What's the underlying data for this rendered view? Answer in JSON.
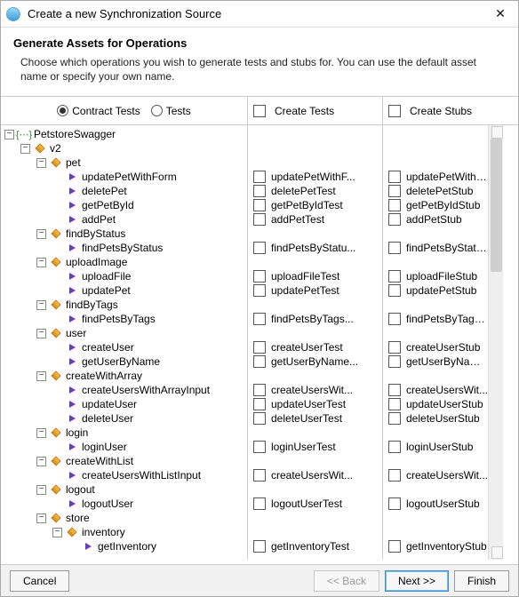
{
  "window": {
    "title": "Create a new Synchronization Source"
  },
  "header": {
    "title": "Generate Assets for Operations",
    "description": "Choose which operations you wish to generate tests and stubs for. You can use the default asset name or specify your own name."
  },
  "columns": {
    "radio_contract": "Contract Tests",
    "radio_tests": "Tests",
    "radio_selected": "contract",
    "create_tests": "Create Tests",
    "create_stubs": "Create Stubs"
  },
  "tree": [
    {
      "indent": 0,
      "exp": "-",
      "icon": "root",
      "label": "PetstoreSwagger",
      "test": "",
      "stub": ""
    },
    {
      "indent": 1,
      "exp": "-",
      "icon": "diamond",
      "label": "v2",
      "test": "",
      "stub": ""
    },
    {
      "indent": 2,
      "exp": "-",
      "icon": "diamond",
      "label": "pet",
      "test": "",
      "stub": ""
    },
    {
      "indent": 3,
      "exp": "",
      "icon": "arrow",
      "label": "updatePetWithForm",
      "test": "updatePetWithF...",
      "stub": "updatePetWithF..."
    },
    {
      "indent": 3,
      "exp": "",
      "icon": "arrow",
      "label": "deletePet",
      "test": "deletePetTest",
      "stub": "deletePetStub"
    },
    {
      "indent": 3,
      "exp": "",
      "icon": "arrow",
      "label": "getPetById",
      "test": "getPetByIdTest",
      "stub": "getPetByIdStub"
    },
    {
      "indent": 3,
      "exp": "",
      "icon": "arrow",
      "label": "addPet",
      "test": "addPetTest",
      "stub": "addPetStub"
    },
    {
      "indent": 2,
      "exp": "-",
      "icon": "diamond",
      "label": "findByStatus",
      "test": "",
      "stub": ""
    },
    {
      "indent": 3,
      "exp": "",
      "icon": "arrow",
      "label": "findPetsByStatus",
      "test": "findPetsByStatu...",
      "stub": "findPetsByStatu..."
    },
    {
      "indent": 2,
      "exp": "-",
      "icon": "diamond",
      "label": "uploadImage",
      "test": "",
      "stub": ""
    },
    {
      "indent": 3,
      "exp": "",
      "icon": "arrow",
      "label": "uploadFile",
      "test": "uploadFileTest",
      "stub": "uploadFileStub"
    },
    {
      "indent": 3,
      "exp": "",
      "icon": "arrow",
      "label": "updatePet",
      "test": "updatePetTest",
      "stub": "updatePetStub"
    },
    {
      "indent": 2,
      "exp": "-",
      "icon": "diamond",
      "label": "findByTags",
      "test": "",
      "stub": ""
    },
    {
      "indent": 3,
      "exp": "",
      "icon": "arrow",
      "label": "findPetsByTags",
      "test": "findPetsByTags...",
      "stub": "findPetsByTags..."
    },
    {
      "indent": 2,
      "exp": "-",
      "icon": "diamond",
      "label": "user",
      "test": "",
      "stub": ""
    },
    {
      "indent": 3,
      "exp": "",
      "icon": "arrow",
      "label": "createUser",
      "test": "createUserTest",
      "stub": "createUserStub"
    },
    {
      "indent": 3,
      "exp": "",
      "icon": "arrow",
      "label": "getUserByName",
      "test": "getUserByName...",
      "stub": "getUserByName..."
    },
    {
      "indent": 2,
      "exp": "-",
      "icon": "diamond",
      "label": "createWithArray",
      "test": "",
      "stub": ""
    },
    {
      "indent": 3,
      "exp": "",
      "icon": "arrow",
      "label": "createUsersWithArrayInput",
      "test": "createUsersWit...",
      "stub": "createUsersWit..."
    },
    {
      "indent": 3,
      "exp": "",
      "icon": "arrow",
      "label": "updateUser",
      "test": "updateUserTest",
      "stub": "updateUserStub"
    },
    {
      "indent": 3,
      "exp": "",
      "icon": "arrow",
      "label": "deleteUser",
      "test": "deleteUserTest",
      "stub": "deleteUserStub"
    },
    {
      "indent": 2,
      "exp": "-",
      "icon": "diamond",
      "label": "login",
      "test": "",
      "stub": ""
    },
    {
      "indent": 3,
      "exp": "",
      "icon": "arrow",
      "label": "loginUser",
      "test": "loginUserTest",
      "stub": "loginUserStub"
    },
    {
      "indent": 2,
      "exp": "-",
      "icon": "diamond",
      "label": "createWithList",
      "test": "",
      "stub": ""
    },
    {
      "indent": 3,
      "exp": "",
      "icon": "arrow",
      "label": "createUsersWithListInput",
      "test": "createUsersWit...",
      "stub": "createUsersWit..."
    },
    {
      "indent": 2,
      "exp": "-",
      "icon": "diamond",
      "label": "logout",
      "test": "",
      "stub": ""
    },
    {
      "indent": 3,
      "exp": "",
      "icon": "arrow",
      "label": "logoutUser",
      "test": "logoutUserTest",
      "stub": "logoutUserStub"
    },
    {
      "indent": 2,
      "exp": "-",
      "icon": "diamond",
      "label": "store",
      "test": "",
      "stub": ""
    },
    {
      "indent": 3,
      "exp": "-",
      "icon": "diamond",
      "label": "inventory",
      "test": "",
      "stub": ""
    },
    {
      "indent": 4,
      "exp": "",
      "icon": "arrow",
      "label": "getInventory",
      "test": "getInventoryTest",
      "stub": "getInventoryStub"
    }
  ],
  "footer": {
    "cancel": "Cancel",
    "back": "<< Back",
    "next": "Next >>",
    "finish": "Finish"
  }
}
